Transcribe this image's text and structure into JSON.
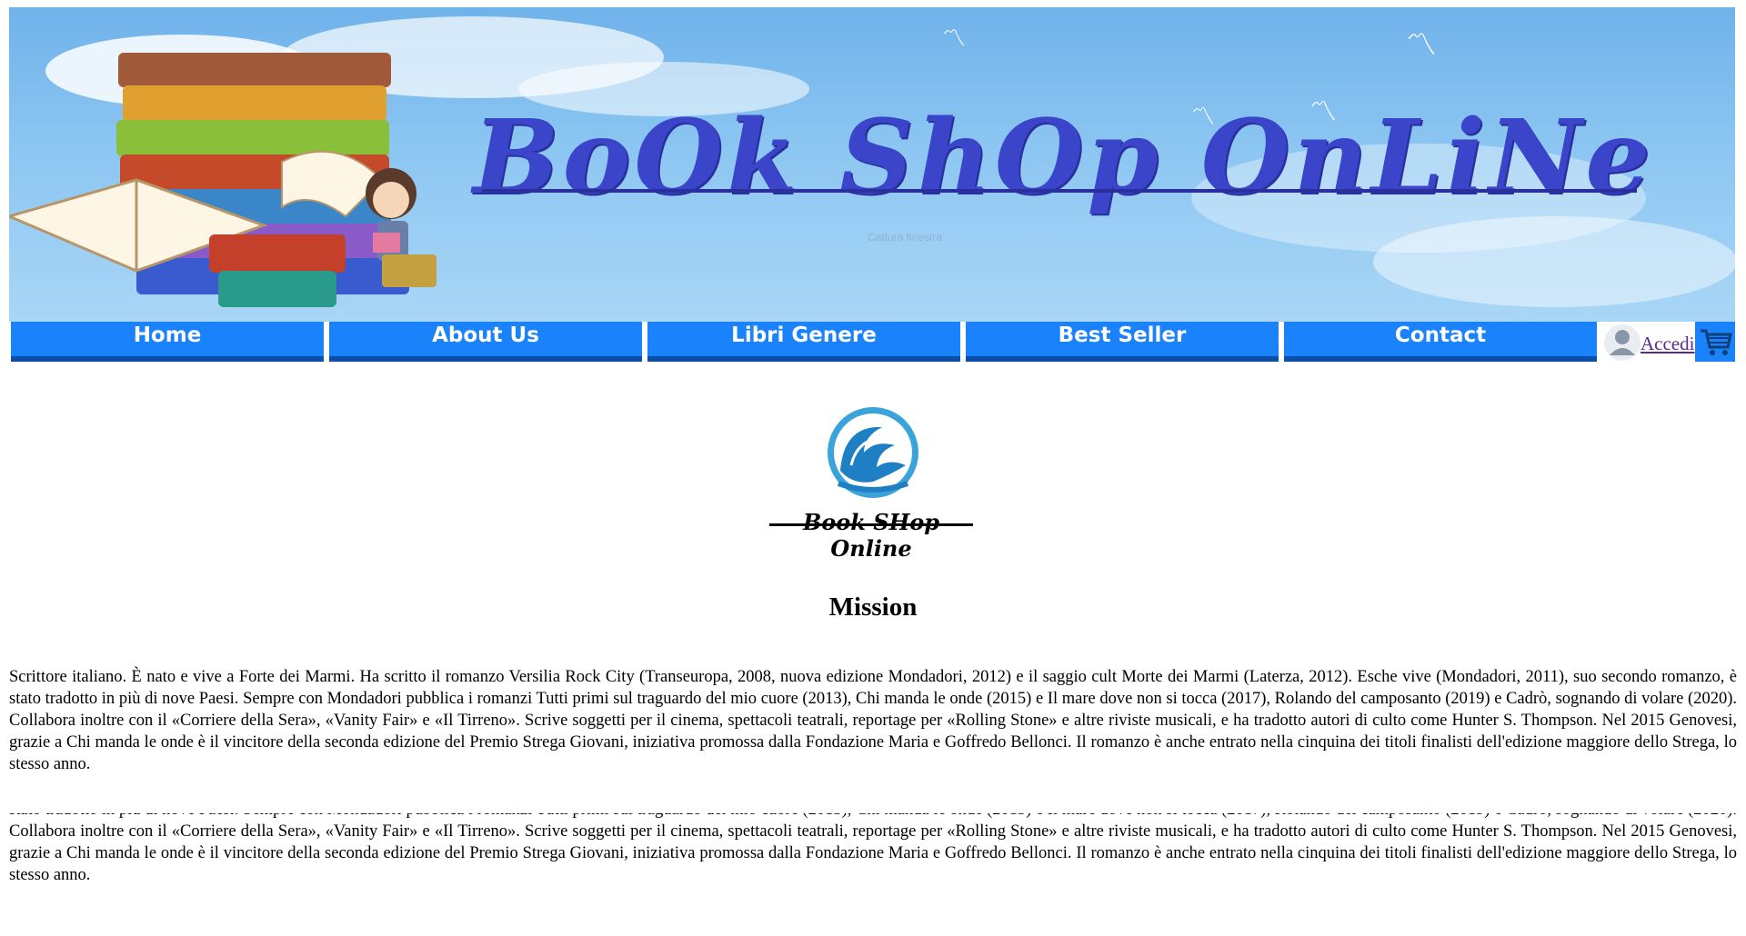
{
  "banner": {
    "title": "BoOk ShOp OnLiNe",
    "watermark": "Cattura finestra"
  },
  "nav": {
    "items": [
      {
        "label": "Home"
      },
      {
        "label": "About Us"
      },
      {
        "label": "Libri Genere"
      },
      {
        "label": "Best Seller"
      },
      {
        "label": "Contact"
      }
    ],
    "login_label": "Accedi",
    "colors": {
      "nav_bg": "#1a82fb",
      "nav_border": "#0b4ea8",
      "link": "#5b2a8a"
    }
  },
  "logo": {
    "text": "Book SHop Online"
  },
  "main": {
    "heading": "Mission",
    "paragraph": "Scrittore italiano. È nato e vive a Forte dei Marmi. Ha scritto il romanzo Versilia Rock City (Transeuropa, 2008, nuova edizione Mondadori, 2012) e il saggio cult Morte dei Marmi (Laterza, 2012). Esche vive (Mondadori, 2011), suo secondo romanzo, è stato tradotto in più di nove Paesi. Sempre con Mondadori pubblica i romanzi Tutti primi sul traguardo del mio cuore (2013), Chi manda le onde (2015) e Il mare dove non si tocca (2017), Rolando del camposanto (2019) e Cadrò, sognando di volare (2020). Collabora inoltre con il «Corriere della Sera», «Vanity Fair» e «Il Tirreno». Scrive soggetti per il cinema, spettacoli teatrali, reportage per «Rolling Stone» e altre riviste musicali, e ha tradotto autori di culto come Hunter S. Thompson. Nel 2015 Genovesi, grazie a Chi manda le onde è il vincitore della seconda edizione del Premio Strega Giovani, iniziativa promossa dalla Fondazione Maria e Goffredo Bellonci. Il romanzo è anche entrato nella cinquina dei titoli finalisti dell'edizione maggiore dello Strega, lo stesso anno."
  }
}
